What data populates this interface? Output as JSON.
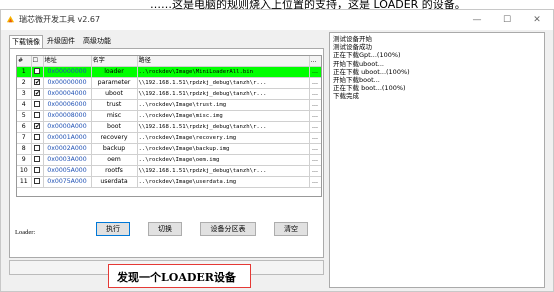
{
  "caption_top": "……这是电脑的规则烧入上位置的支持，这是 LOADER 的设备。",
  "window": {
    "title": "瑞芯微开发工具 v2.67",
    "minimize": "—",
    "maximize": "☐",
    "close": "✕"
  },
  "tabs": [
    "下载镜像",
    "升级固件",
    "高级功能"
  ],
  "table": {
    "headers": [
      "#",
      "☐",
      "地址",
      "名字",
      "路径",
      "..."
    ],
    "rows": [
      {
        "num": "1",
        "checked": "",
        "addr": "0x00000000",
        "name": "loader",
        "path": "..\\rockdev\\Image\\MiniLoaderAll.bin",
        "more": "..."
      },
      {
        "num": "2",
        "checked": "✔",
        "addr": "0x00000000",
        "name": "parameter",
        "path": "\\\\192.168.1.51\\rpdzkj_debug\\tanzh\\r...",
        "more": "..."
      },
      {
        "num": "3",
        "checked": "✔",
        "addr": "0x00004000",
        "name": "uboot",
        "path": "\\\\192.168.1.51\\rpdzkj_debug\\tanzh\\r...",
        "more": "..."
      },
      {
        "num": "4",
        "checked": "",
        "addr": "0x00006000",
        "name": "trust",
        "path": "..\\rockdev\\Image\\trust.img",
        "more": "..."
      },
      {
        "num": "5",
        "checked": "",
        "addr": "0x00008000",
        "name": "misc",
        "path": "..\\rockdev\\Image\\misc.img",
        "more": "..."
      },
      {
        "num": "6",
        "checked": "✔",
        "addr": "0x0000A000",
        "name": "boot",
        "path": "\\\\192.168.1.51\\rpdzkj_debug\\tanzh\\r...",
        "more": "..."
      },
      {
        "num": "7",
        "checked": "",
        "addr": "0x0001A000",
        "name": "recovery",
        "path": "..\\rockdev\\Image\\recovery.img",
        "more": "..."
      },
      {
        "num": "8",
        "checked": "",
        "addr": "0x0002A000",
        "name": "backup",
        "path": "..\\rockdev\\Image\\backup.img",
        "more": "..."
      },
      {
        "num": "9",
        "checked": "",
        "addr": "0x0003A000",
        "name": "oem",
        "path": "..\\rockdev\\Image\\oem.img",
        "more": "..."
      },
      {
        "num": "10",
        "checked": "",
        "addr": "0x0005A000",
        "name": "rootfs",
        "path": "\\\\192.168.1.51\\rpdzkj_debug\\tanzh\\r...",
        "more": "..."
      },
      {
        "num": "11",
        "checked": "",
        "addr": "0x0075A000",
        "name": "userdata",
        "path": "..\\rockdev\\Image\\userdata.img",
        "more": "..."
      }
    ]
  },
  "loader_label": "Loader:",
  "buttons": {
    "run": "执行",
    "switch": "切换",
    "partition": "设备分区表",
    "clear": "清空"
  },
  "log": [
    "测试设备开始",
    "测试设备成功",
    "正在下载Gpt...(100%)",
    "开始下载uboot...",
    "正在下载 uboot...(100%)",
    "开始下载boot...",
    "正在下载 boot...(100%)",
    "下载完成"
  ],
  "status": {
    "callout": "发现一个LOADER设备"
  },
  "colors": {
    "row_highlight": "#00ff00",
    "callout_border": "#e53935",
    "address_text": "#1e50b4",
    "primary_button_border": "#0078d7"
  }
}
